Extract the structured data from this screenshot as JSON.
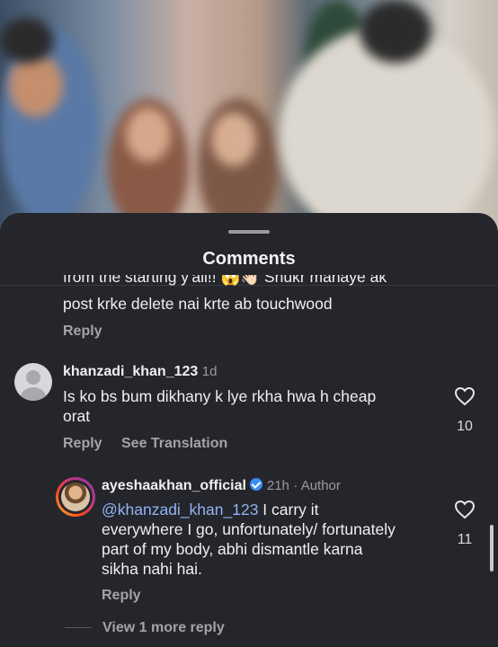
{
  "sheet": {
    "title": "Comments"
  },
  "comments": [
    {
      "partial_line": "from the starting y'all!! 😱👋🏻 Shukr manaye ak",
      "text_line2": "post krke delete nai krte ab touchwood",
      "reply_label": "Reply"
    },
    {
      "username": "khanzadi_khan_123",
      "time": "1d",
      "text_line1": "Is ko bs bum dikhany k lye rkha hwa h cheap",
      "text_line2": "orat",
      "reply_label": "Reply",
      "translate_label": "See Translation",
      "like_count": "10",
      "avatar_icon": "default-avatar-icon",
      "replies": [
        {
          "username": "ayeshaakhan_official",
          "time": "21h",
          "author_tag": "· Author",
          "mention": "@khanzadi_khan_123",
          "text_line1_rest": " I carry it",
          "text_line2": "everywhere I go, unfortunately/ fortunately",
          "text_line3": "part of my body, abhi dismantle karna",
          "text_line4": "sikha nahi hai.",
          "reply_label": "Reply",
          "like_count": "11",
          "verified_icon": "verified-badge-icon"
        }
      ],
      "view_more_label": "View 1 more reply"
    }
  ],
  "colors": {
    "sheet_bg": "#25262b",
    "mention": "#8fb4f5",
    "verified": "#3b8cf5"
  }
}
